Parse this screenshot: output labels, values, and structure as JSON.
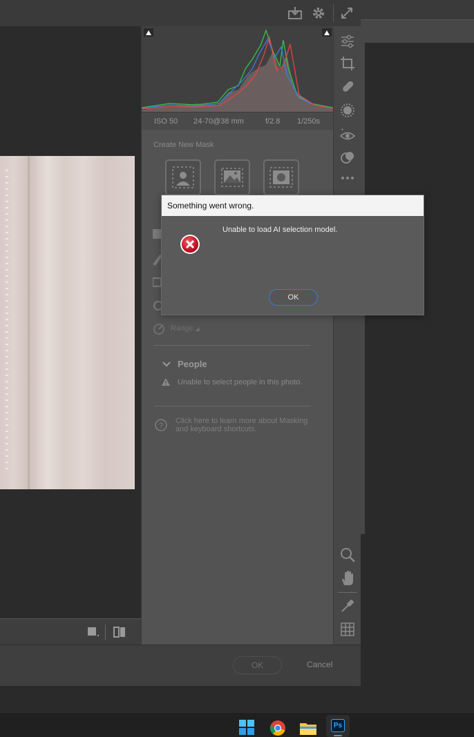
{
  "histogram": {
    "iso": "ISO 50",
    "lens": "24-70@38 mm",
    "aperture": "f/2.8",
    "shutter": "1/250s"
  },
  "mask_panel": {
    "create_label": "Create New Mask",
    "range_label": "Range",
    "people_heading": "People",
    "people_warning": "Unable to select people in this photo.",
    "help_line1": "Click here to learn more about Masking",
    "help_line2": "and keyboard shortcuts."
  },
  "dialog": {
    "title": "Something went wrong.",
    "message": "Unable to load AI selection model.",
    "ok_label": "OK"
  },
  "footer": {
    "ok_label": "OK",
    "cancel_label": "Cancel"
  },
  "taskbar": {
    "ps_label": "Ps"
  },
  "colors": {
    "accent_blue": "#3b7bd8",
    "error_red": "#c8102e",
    "panel_bg": "#535353"
  }
}
